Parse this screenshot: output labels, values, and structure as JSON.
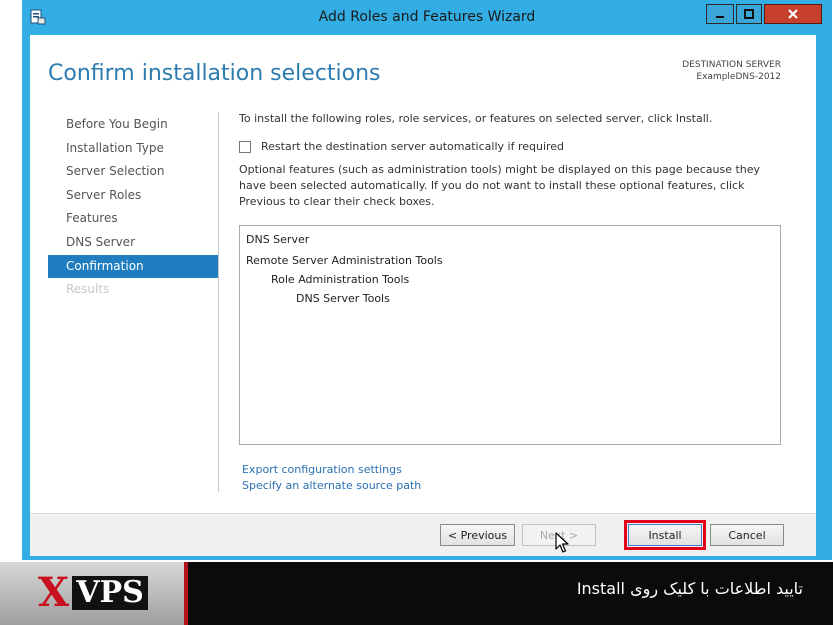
{
  "window": {
    "title": "Add Roles and Features Wizard",
    "minimize_icon": "minimize-icon",
    "maximize_icon": "maximize-icon",
    "close_icon": "close-icon"
  },
  "header": {
    "page_title": "Confirm installation selections",
    "destination_label": "DESTINATION SERVER",
    "destination_server": "ExampleDNS-2012"
  },
  "nav": {
    "items": [
      {
        "label": "Before You Begin",
        "state": "normal"
      },
      {
        "label": "Installation Type",
        "state": "normal"
      },
      {
        "label": "Server Selection",
        "state": "normal"
      },
      {
        "label": "Server Roles",
        "state": "normal"
      },
      {
        "label": "Features",
        "state": "normal"
      },
      {
        "label": "DNS Server",
        "state": "normal"
      },
      {
        "label": "Confirmation",
        "state": "active"
      },
      {
        "label": "Results",
        "state": "disabled"
      }
    ]
  },
  "content": {
    "intro": "To install the following roles, role services, or features on selected server, click Install.",
    "restart_label": "Restart the destination server automatically if required",
    "restart_checked": false,
    "optional_text": "Optional features (such as administration tools) might be displayed on this page because they have been selected automatically. If you do not want to install these optional features, click Previous to clear their check boxes.",
    "features": [
      {
        "label": "DNS Server",
        "level": 0
      },
      {
        "label": "Remote Server Administration Tools",
        "level": 0
      },
      {
        "label": "Role Administration Tools",
        "level": 1
      },
      {
        "label": "DNS Server Tools",
        "level": 2
      }
    ],
    "links": {
      "export": "Export configuration settings",
      "alternate": "Specify an alternate source path"
    }
  },
  "footer": {
    "previous": "< Previous",
    "next": "Next >",
    "install": "Install",
    "cancel": "Cancel"
  },
  "banner": {
    "logo_x": "X",
    "logo_vps": "VPS",
    "caption": "تایید اطلاعات با کلیک روی Install"
  },
  "colors": {
    "window_frame": "#33aee4",
    "title_accent": "#2c7cb0",
    "nav_active": "#1f7dc0",
    "install_highlight": "#e2001a",
    "close_button": "#c7402e"
  }
}
